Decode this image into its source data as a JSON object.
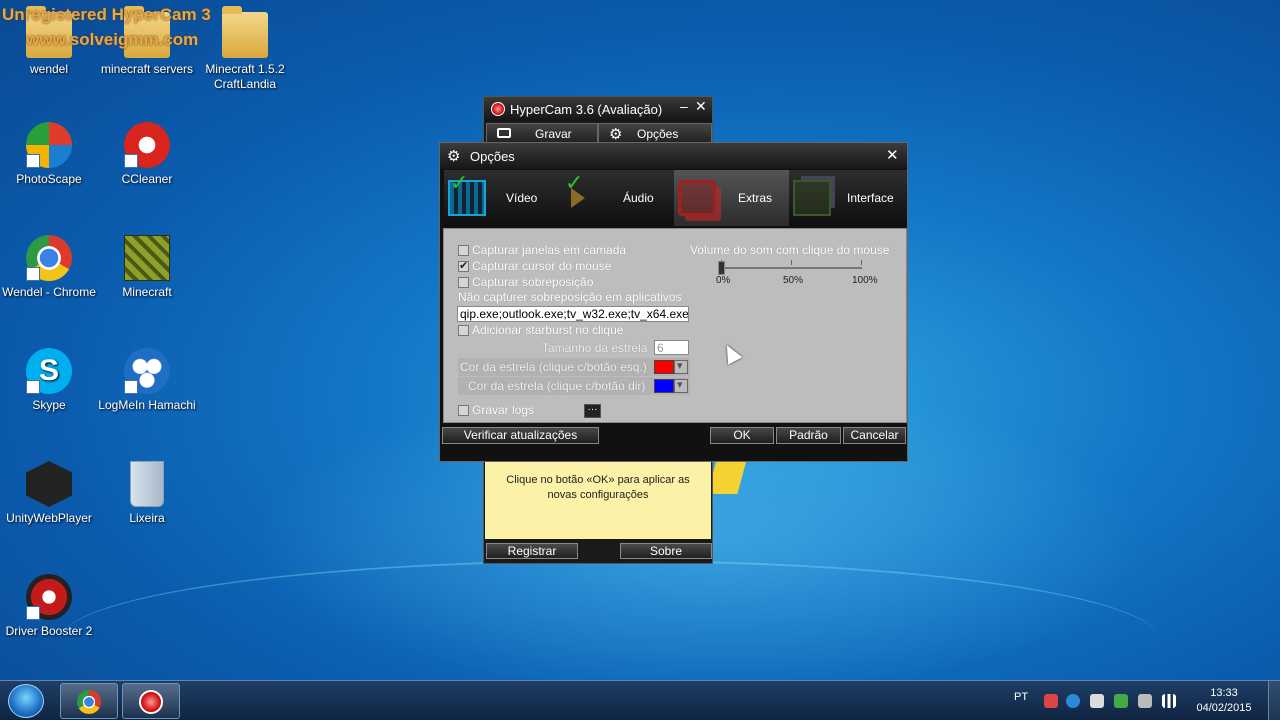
{
  "watermark": {
    "line1": "Unregistered HyperCam 3",
    "line2": "www.solveigmm.com"
  },
  "desktop": {
    "icons": [
      {
        "name": "wendel",
        "label": "wendel",
        "icon": "folder-icon"
      },
      {
        "name": "minecraft-servers",
        "label": "minecraft servers",
        "icon": "folder-icon"
      },
      {
        "name": "minecraft-craftlandia",
        "label": "Minecraft 1.5.2 CraftLandia",
        "icon": "folder-icon"
      },
      {
        "name": "photoscape",
        "label": "PhotoScape",
        "icon": "photoscape-icon"
      },
      {
        "name": "ccleaner",
        "label": "CCleaner",
        "icon": "ccleaner-icon"
      },
      {
        "name": "wendel-chrome",
        "label": "Wendel - Chrome",
        "icon": "chrome-icon"
      },
      {
        "name": "minecraft",
        "label": "Minecraft",
        "icon": "minecraft-icon"
      },
      {
        "name": "skype",
        "label": "Skype",
        "icon": "skype-icon"
      },
      {
        "name": "logmein-hamachi",
        "label": "LogMeIn Hamachi",
        "icon": "hamachi-icon"
      },
      {
        "name": "unitywebplayer",
        "label": "UnityWebPlayer",
        "icon": "unity-icon"
      },
      {
        "name": "lixeira",
        "label": "Lixeira",
        "icon": "recycle-bin-icon"
      },
      {
        "name": "driver-booster",
        "label": "Driver Booster 2",
        "icon": "driver-booster-icon"
      }
    ]
  },
  "hypercam": {
    "title": "HyperCam 3.6 (Avaliação)",
    "minimize": "–",
    "close": "✕",
    "tabs": {
      "record": "Gravar",
      "options": "Opções"
    },
    "info": "Clique no botão «OK» para aplicar as novas configurações",
    "register": "Registrar",
    "about": "Sobre"
  },
  "options": {
    "title": "Opções",
    "close": "✕",
    "tabs": [
      {
        "label": "Vídeo"
      },
      {
        "label": "Áudio"
      },
      {
        "label": "Extras"
      },
      {
        "label": "Interface"
      }
    ],
    "active_tab": "Extras",
    "capture_layered": {
      "label": "Capturar janelas em camada",
      "checked": false
    },
    "capture_cursor": {
      "label": "Capturar cursor do mouse",
      "checked": true
    },
    "capture_overlay": {
      "label": "Capturar sobreposição",
      "checked": false
    },
    "exclude_label": "Não capturer sobreposição em aplicativos",
    "exclude_value": "qip.exe;outlook.exe;tv_w32.exe;tv_x64.exe",
    "starburst": {
      "label": "Adicionar starburst no clique",
      "checked": false
    },
    "star_size_label": "Tamanho da estrela",
    "star_size_value": "6",
    "star_color_left_label": "Cor da estrela (clique c/botão esq.)",
    "star_color_left": "#ff0000",
    "star_color_right_label": "Cor da estrela (clique c/botão dir)",
    "star_color_right": "#0000ff",
    "logs": {
      "label": "Gravar logs",
      "checked": false
    },
    "logs_browse": "···",
    "volume": {
      "label": "Volume do som com clique do mouse",
      "value_percent": 0,
      "ticks": [
        "0%",
        "50%",
        "100%"
      ]
    },
    "buttons": {
      "updates": "Verificar atualizações",
      "ok": "OK",
      "default": "Padrão",
      "cancel": "Cancelar"
    }
  },
  "taskbar": {
    "language": "PT",
    "time": "13:33",
    "date": "04/02/2015"
  }
}
